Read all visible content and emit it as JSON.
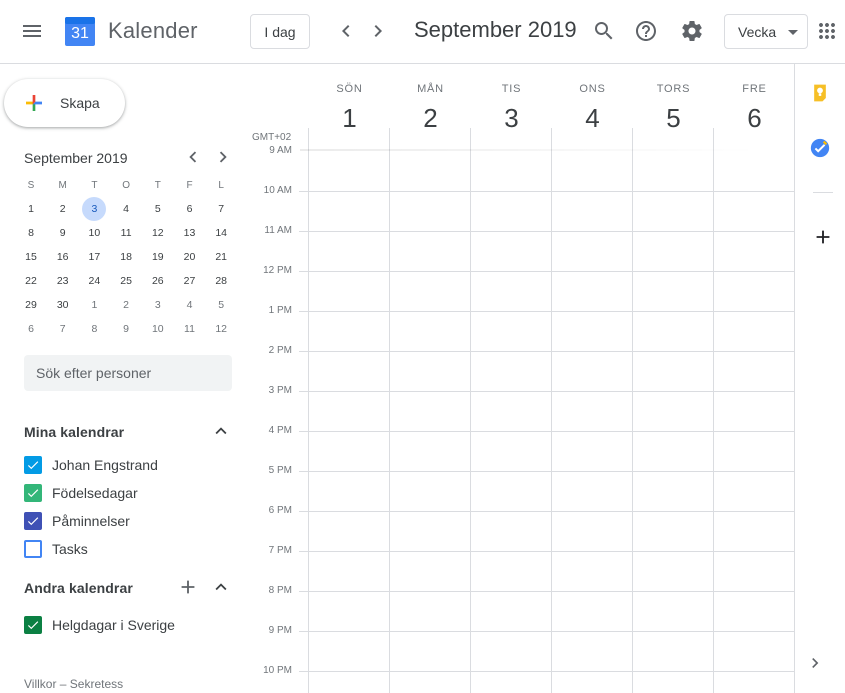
{
  "app": {
    "title": "Kalender",
    "logo_number": "31"
  },
  "header": {
    "today_label": "I dag",
    "current_range": "September 2019",
    "view_label": "Vecka"
  },
  "sidebar": {
    "create_label": "Skapa",
    "mini_calendar": {
      "title": "September 2019",
      "weekdays": [
        "S",
        "M",
        "T",
        "O",
        "T",
        "F",
        "L"
      ],
      "weeks": [
        [
          "1",
          "2",
          "3",
          "4",
          "5",
          "6",
          "7"
        ],
        [
          "8",
          "9",
          "10",
          "11",
          "12",
          "13",
          "14"
        ],
        [
          "15",
          "16",
          "17",
          "18",
          "19",
          "20",
          "21"
        ],
        [
          "22",
          "23",
          "24",
          "25",
          "26",
          "27",
          "28"
        ],
        [
          "29",
          "30",
          "1",
          "2",
          "3",
          "4",
          "5"
        ],
        [
          "6",
          "7",
          "8",
          "9",
          "10",
          "11",
          "12"
        ]
      ],
      "selected_day": "3"
    },
    "search_placeholder": "Sök efter personer",
    "my_calendars": {
      "title": "Mina kalendrar",
      "items": [
        {
          "name": "Johan Engstrand",
          "checked": true,
          "color": "#039be5"
        },
        {
          "name": "Födelsedagar",
          "checked": true,
          "color": "#33b679"
        },
        {
          "name": "Påminnelser",
          "checked": true,
          "color": "#3f51b5"
        },
        {
          "name": "Tasks",
          "checked": false,
          "color": "#4285f4"
        }
      ]
    },
    "other_calendars": {
      "title": "Andra kalendrar",
      "items": [
        {
          "name": "Helgdagar i Sverige",
          "checked": true,
          "color": "#0b8043"
        }
      ]
    },
    "footer": "Villkor – Sekretess"
  },
  "week": {
    "timezone": "GMT+02",
    "days": [
      {
        "name": "SÖN",
        "date": "1"
      },
      {
        "name": "MÅN",
        "date": "2"
      },
      {
        "name": "TIS",
        "date": "3"
      },
      {
        "name": "ONS",
        "date": "4"
      },
      {
        "name": "TORS",
        "date": "5"
      },
      {
        "name": "FRE",
        "date": "6"
      }
    ],
    "hours": [
      "9 AM",
      "10 AM",
      "11 AM",
      "12 PM",
      "1 PM",
      "2 PM",
      "3 PM",
      "4 PM",
      "5 PM",
      "6 PM",
      "7 PM",
      "8 PM",
      "9 PM",
      "10 PM"
    ]
  },
  "side_panel": {
    "icons": [
      "keep-icon",
      "tasks-icon",
      "add-addon-icon",
      "expand-panel-icon"
    ],
    "keep_color": "#f6bf26",
    "tasks_color": "#4285f4"
  }
}
